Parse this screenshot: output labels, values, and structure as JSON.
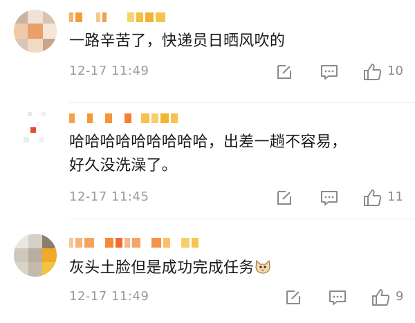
{
  "comments": [
    {
      "text": "一路辛苦了，快递员日晒风吹的",
      "time": "12-17 11:49",
      "likes": "10"
    },
    {
      "text_line1": "哈哈哈哈哈哈哈哈哈，出差一趟不容易，",
      "text_line2": "好久没洗澡了。",
      "time": "12-17 11:45",
      "likes": "11"
    },
    {
      "text": "灰头土脸但是成功完成任务",
      "emoji": "cat-face-emoji",
      "time": "12-17 11:49",
      "likes": "9"
    }
  ],
  "icons": {
    "share": "edit-share-icon",
    "reply": "comment-bubble-icon",
    "like": "thumbs-up-icon"
  },
  "colors": {
    "text": "#1a1a1a",
    "meta": "#9a9a9a",
    "icon": "#8a8a8a",
    "username_blur": "#f5a623"
  }
}
